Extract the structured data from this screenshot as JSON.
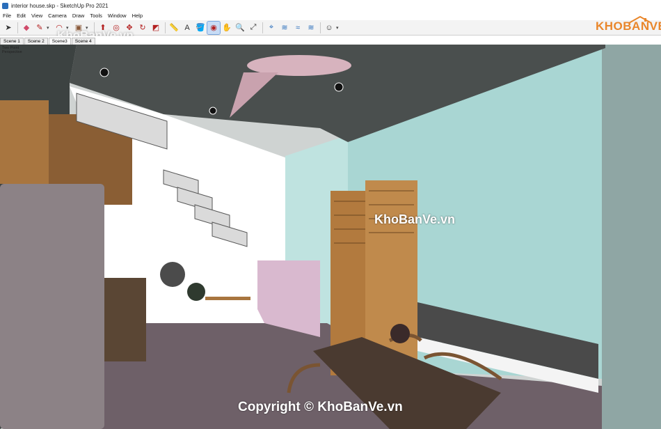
{
  "window": {
    "title": "interior house.skp - SketchUp Pro 2021"
  },
  "menu": [
    "File",
    "Edit",
    "View",
    "Camera",
    "Draw",
    "Tools",
    "Window",
    "Help"
  ],
  "toolbar": {
    "tools": [
      {
        "name": "select-tool",
        "glyph": "➤"
      },
      {
        "name": "eraser-tool",
        "glyph": "◆"
      },
      {
        "name": "line-tool",
        "glyph": "✎"
      },
      {
        "name": "arc-tool",
        "glyph": "◠"
      },
      {
        "name": "shape-tool",
        "glyph": "▣"
      },
      {
        "name": "push-pull-tool",
        "glyph": "⬆"
      },
      {
        "name": "offset-tool",
        "glyph": "◎"
      },
      {
        "name": "move-tool",
        "glyph": "✥"
      },
      {
        "name": "rotate-tool",
        "glyph": "↻"
      },
      {
        "name": "scale-tool",
        "glyph": "◩"
      },
      {
        "name": "tape-measure-tool",
        "glyph": "📏"
      },
      {
        "name": "text-tool",
        "glyph": "A"
      },
      {
        "name": "paint-bucket-tool",
        "glyph": "🪣"
      },
      {
        "name": "orbit-tool",
        "glyph": "◉"
      },
      {
        "name": "pan-tool",
        "glyph": "✋"
      },
      {
        "name": "zoom-tool",
        "glyph": "🔍"
      },
      {
        "name": "zoom-extents-tool",
        "glyph": "⤢"
      },
      {
        "name": "position-camera-tool",
        "glyph": "⌖"
      },
      {
        "name": "walk-tool",
        "glyph": "≋"
      },
      {
        "name": "section-plane-tool",
        "glyph": "≈"
      },
      {
        "name": "sandbox-tool",
        "glyph": "≋"
      },
      {
        "name": "account-icon",
        "glyph": "☺"
      }
    ]
  },
  "scenes": [
    "Scene 1",
    "Scene 2",
    "Scene3",
    "Scene 4"
  ],
  "viewport": {
    "label_line1": "Two Point",
    "label_line2": "Perspective"
  },
  "branding": {
    "logo_text": "KHOBANVE",
    "watermark_toolbar": "KhoBanVe.vn",
    "watermark_center": "KhoBanVe.vn",
    "copyright": "Copyright © KhoBanVe.vn"
  },
  "colors": {
    "accent": "#e9862a",
    "ceiling": "#4a4f4e",
    "floor": "#6e6068",
    "glass": "#a9d6d3",
    "wood": "#b27a3e"
  }
}
